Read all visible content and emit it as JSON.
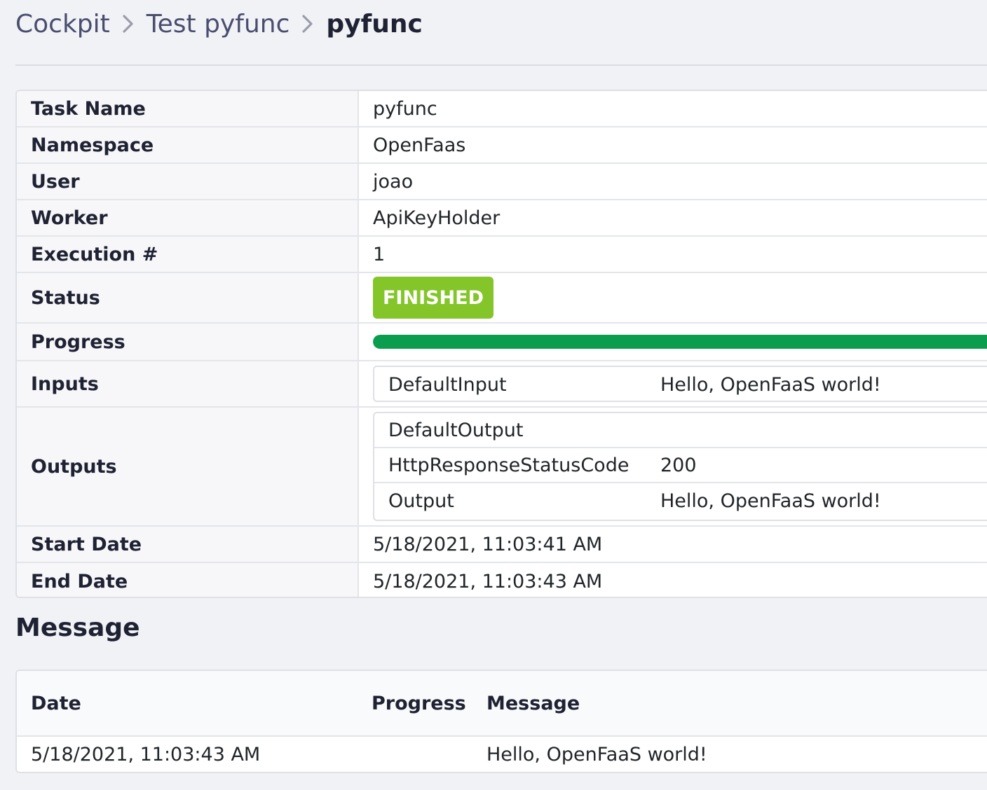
{
  "breadcrumb": {
    "items": [
      "Cockpit",
      "Test pyfunc"
    ],
    "current": "pyfunc"
  },
  "details": {
    "task_name": {
      "label": "Task Name",
      "value": "pyfunc"
    },
    "namespace": {
      "label": "Namespace",
      "value": "OpenFaas"
    },
    "user": {
      "label": "User",
      "value": "joao"
    },
    "worker": {
      "label": "Worker",
      "value": "ApiKeyHolder"
    },
    "execution": {
      "label": "Execution #",
      "value": "1"
    },
    "status": {
      "label": "Status",
      "value": "FINISHED",
      "color": "#84c52a"
    },
    "progress": {
      "label": "Progress",
      "percent": 100,
      "color": "#0b9d4e"
    },
    "inputs": {
      "label": "Inputs",
      "rows": [
        {
          "key": "DefaultInput",
          "value": "Hello, OpenFaaS world!"
        }
      ]
    },
    "outputs": {
      "label": "Outputs",
      "rows": [
        {
          "key": "DefaultOutput",
          "value": ""
        },
        {
          "key": "HttpResponseStatusCode",
          "value": "200"
        },
        {
          "key": "Output",
          "value": "Hello, OpenFaaS world!"
        }
      ]
    },
    "start_date": {
      "label": "Start Date",
      "value": "5/18/2021, 11:03:41 AM"
    },
    "end_date": {
      "label": "End Date",
      "value": "5/18/2021, 11:03:43 AM"
    }
  },
  "message_section": {
    "title": "Message",
    "columns": [
      "Date",
      "Progress",
      "Message"
    ],
    "rows": [
      {
        "date": "5/18/2021, 11:03:43 AM",
        "progress": "",
        "message": "Hello, OpenFaaS world!"
      }
    ]
  },
  "icons": {
    "breadcrumb_separator": "chevron-right-icon"
  }
}
